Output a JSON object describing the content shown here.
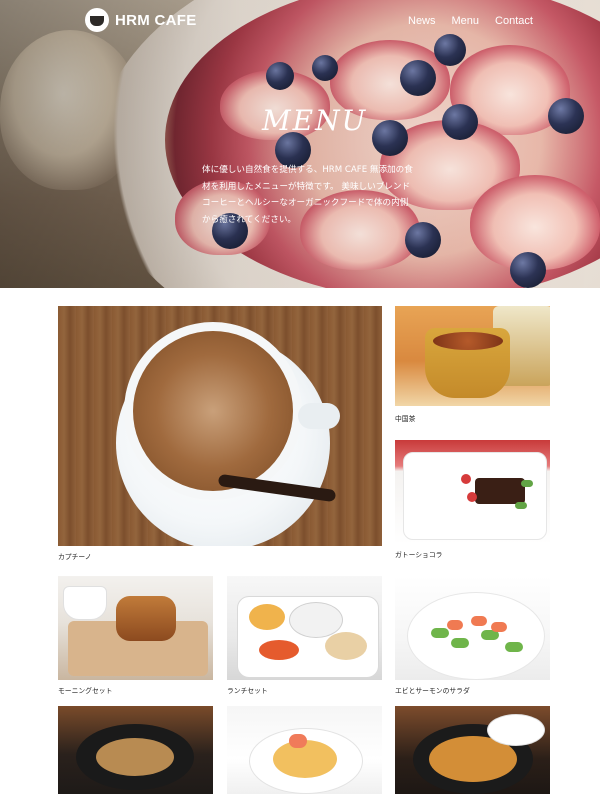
{
  "brand": {
    "name": "HRM CAFE",
    "logo_text": "COFFEE"
  },
  "nav": {
    "items": [
      "News",
      "Menu",
      "Contact"
    ]
  },
  "hero": {
    "title": "MENU",
    "description": "体に優しい自然食を提供する、HRM CAFE 無添加の食材を利用したメニューが特徴です。 美味しいブレンドコーヒーとヘルシーなオーガニックフードで体の内側から癒されてください。"
  },
  "menu_items": [
    {
      "label": "カプチーノ"
    },
    {
      "label": "中国茶"
    },
    {
      "label": "ガトーショコラ"
    },
    {
      "label": "モーニングセット"
    },
    {
      "label": "ランチセット"
    },
    {
      "label": "エビとサーモンのサラダ"
    }
  ],
  "colors": {
    "nav_text": "#ffffff",
    "caption_text": "#222222",
    "accent_berry": "#2c3355"
  }
}
